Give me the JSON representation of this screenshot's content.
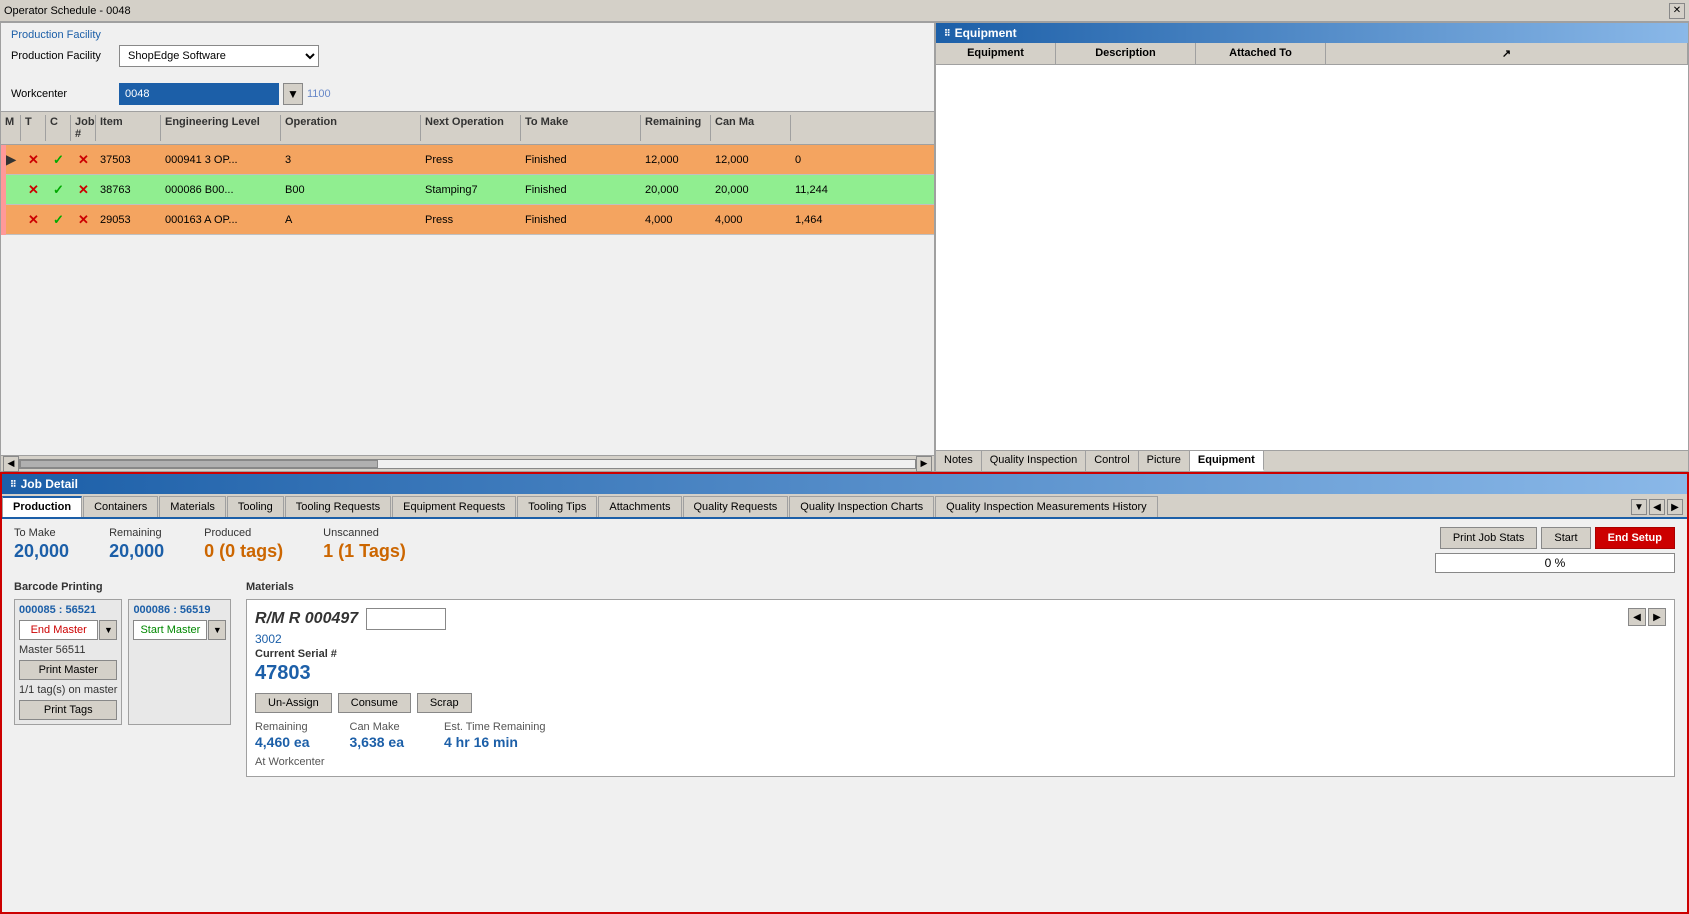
{
  "window": {
    "title": "Operator Schedule - 0048",
    "close_label": "✕"
  },
  "facility": {
    "section_label": "Production Facility",
    "field_label": "Production Facility",
    "value": "ShopEdge Software",
    "options": [
      "ShopEdge Software"
    ]
  },
  "workcenter": {
    "label": "Workcenter",
    "value": "0048",
    "number": "1100"
  },
  "table": {
    "headers": [
      "M",
      "T",
      "C",
      "Job #",
      "Item",
      "Engineering Level",
      "Operation",
      "Next Operation",
      "To Make",
      "Remaining",
      "Can Ma"
    ],
    "rows": [
      {
        "arrow": "▶",
        "marks": [
          "x",
          "check",
          "x"
        ],
        "pink": true,
        "job_num": "37503",
        "item": "000941  3  OP...",
        "eng_level": "3",
        "operation": "Press",
        "next_op": "Finished",
        "to_make": "12,000",
        "remaining": "12,000",
        "can_make": "0",
        "style": "orange"
      },
      {
        "arrow": "",
        "marks": [
          "x",
          "check",
          "x"
        ],
        "pink": true,
        "job_num": "38763",
        "item": "000086  B00...",
        "eng_level": "B00",
        "operation": "Stamping7",
        "next_op": "Finished",
        "to_make": "20,000",
        "remaining": "20,000",
        "can_make": "11,244",
        "style": "green"
      },
      {
        "arrow": "",
        "marks": [
          "x",
          "check",
          "x"
        ],
        "pink": true,
        "job_num": "29053",
        "item": "000163  A  OP...",
        "eng_level": "A",
        "operation": "Press",
        "next_op": "Finished",
        "to_make": "4,000",
        "remaining": "4,000",
        "can_make": "1,464",
        "style": "orange"
      }
    ]
  },
  "equipment_panel": {
    "title": "Equipment",
    "headers": [
      "Equipment",
      "Description",
      "Attached To",
      ""
    ],
    "tabs": [
      "Notes",
      "Quality Inspection",
      "Control",
      "Picture",
      "Equipment"
    ]
  },
  "job_detail": {
    "title": "Job Detail",
    "tabs": [
      "Production",
      "Containers",
      "Materials",
      "Tooling",
      "Tooling Requests",
      "Equipment Requests",
      "Tooling Tips",
      "Attachments",
      "Quality Requests",
      "Quality Inspection Charts",
      "Quality Inspection Measurements History"
    ],
    "active_tab": "Materials",
    "stats": {
      "to_make_label": "To Make",
      "to_make_value": "20,000",
      "remaining_label": "Remaining",
      "remaining_value": "20,000",
      "produced_label": "Produced",
      "produced_value": "0 (0 tags)",
      "unscanned_label": "Unscanned",
      "unscanned_value": "1 (1 Tags)"
    },
    "buttons": {
      "print_job_stats": "Print Job Stats",
      "start": "Start",
      "end_setup": "End Setup",
      "progress": "0 %"
    },
    "barcode": {
      "section_label": "Barcode Printing",
      "panel1_title": "000085 : 56521",
      "panel1_btn": "End Master",
      "panel1_master_label": "Master 56511",
      "panel1_print_master": "Print Master",
      "panel1_tag_count": "1/1 tag(s) on master",
      "panel1_print_tags": "Print Tags",
      "panel2_title": "000086 : 56519",
      "panel2_btn": "Start Master"
    },
    "materials": {
      "section_label": "Materials",
      "rm_number": "R/M R 000497",
      "code": "3002",
      "current_serial_label": "Current Serial #",
      "current_serial": "47803",
      "btn_unassign": "Un-Assign",
      "btn_consume": "Consume",
      "btn_scrap": "Scrap",
      "remaining_label": "Remaining",
      "remaining_value": "4,460 ea",
      "can_make_label": "Can Make",
      "can_make_value": "3,638 ea",
      "est_time_label": "Est. Time Remaining",
      "est_time_value": "4 hr 16 min",
      "at_workcenter_label": "At Workcenter"
    }
  }
}
